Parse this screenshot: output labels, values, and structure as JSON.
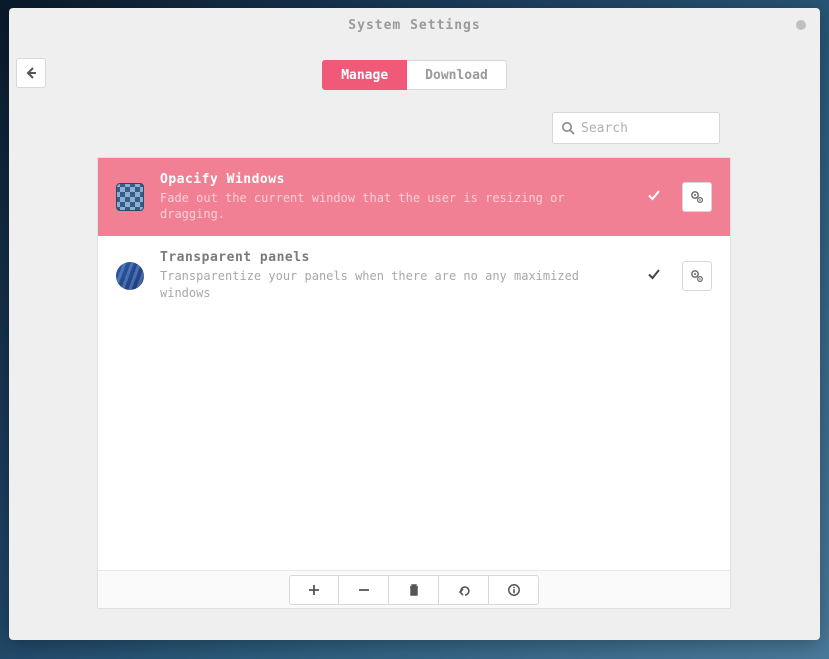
{
  "window": {
    "title": "System Settings"
  },
  "tabs": {
    "manage": "Manage",
    "download": "Download",
    "active": "manage"
  },
  "search": {
    "placeholder": "Search",
    "value": ""
  },
  "extensions": [
    {
      "title": "Opacify Windows",
      "description": "Fade out the current window that the user is resizing or dragging.",
      "enabled": true,
      "selected": true,
      "icon": "opacify"
    },
    {
      "title": "Transparent panels",
      "description": "Transparentize your panels when there are no any maximized windows",
      "enabled": true,
      "selected": false,
      "icon": "panels"
    }
  ],
  "toolbar_icons": [
    "plus",
    "minus",
    "trash",
    "undo",
    "info"
  ]
}
